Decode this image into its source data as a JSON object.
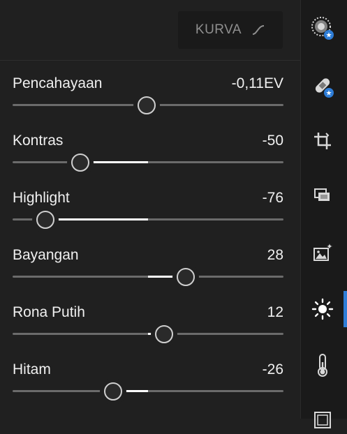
{
  "header": {
    "curve_button_label": "KURVA"
  },
  "sliders": [
    {
      "label": "Pencahayaan",
      "value": "-0,11EV",
      "level": -0.011
    },
    {
      "label": "Kontras",
      "value": "-50",
      "level": -0.5
    },
    {
      "label": "Highlight",
      "value": "-76",
      "level": -0.76
    },
    {
      "label": "Bayangan",
      "value": "28",
      "level": 0.28
    },
    {
      "label": "Rona Putih",
      "value": "12",
      "level": 0.12
    },
    {
      "label": "Hitam",
      "value": "-26",
      "level": -0.26
    }
  ],
  "rail": {
    "icons": [
      "selective-mask-icon",
      "healing-brush-icon",
      "crop-icon",
      "presets-icon",
      "auto-enhance-icon",
      "light-icon",
      "color-temperature-icon",
      "effects-icon"
    ],
    "active": "light-icon",
    "accent_color": "#2e7dd7"
  },
  "colors": {
    "track": "#6b6b6b",
    "fill": "#ffffff",
    "thumb_border": "#cfcfcf"
  }
}
